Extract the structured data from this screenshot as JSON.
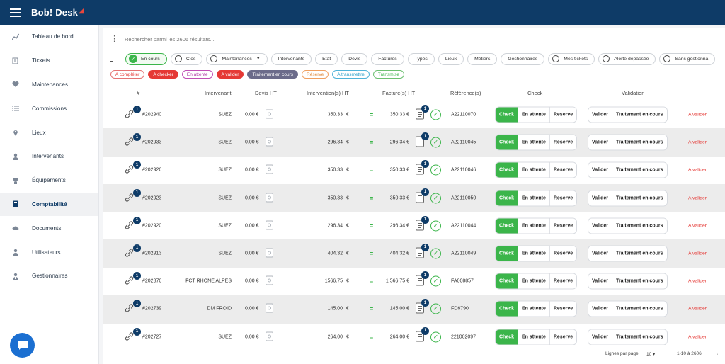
{
  "app": {
    "brand": "Bob! Desk"
  },
  "sidebar": {
    "items": [
      {
        "label": "Tableau de bord",
        "icon": "chart-line-icon",
        "active": false
      },
      {
        "label": "Tickets",
        "icon": "tickets-icon",
        "active": false
      },
      {
        "label": "Maintenances",
        "icon": "heart-pulse-icon",
        "active": false
      },
      {
        "label": "Commissions",
        "icon": "checklist-icon",
        "active": false
      },
      {
        "label": "Lieux",
        "icon": "map-pin-icon",
        "active": false
      },
      {
        "label": "Intervenants",
        "icon": "worker-icon",
        "active": false
      },
      {
        "label": "Équipements",
        "icon": "equipment-icon",
        "active": false
      },
      {
        "label": "Comptabilité",
        "icon": "calculator-icon",
        "active": true
      },
      {
        "label": "Documents",
        "icon": "cloud-icon",
        "active": false
      },
      {
        "label": "Utilisateurs",
        "icon": "user-icon",
        "active": false
      },
      {
        "label": "Gestionnaires",
        "icon": "manager-icon",
        "active": false
      }
    ]
  },
  "search": {
    "placeholder": "Rechercher parmi les 2606 résultats..."
  },
  "filters": [
    {
      "label": "En cours",
      "state": "checked"
    },
    {
      "label": "Clos",
      "state": "radio"
    },
    {
      "label": "Maintenances",
      "state": "radio-dropdown"
    },
    {
      "label": "Intervenants",
      "state": "plain"
    },
    {
      "label": "Etat",
      "state": "plain"
    },
    {
      "label": "Devis",
      "state": "plain"
    },
    {
      "label": "Factures",
      "state": "plain"
    },
    {
      "label": "Types",
      "state": "plain"
    },
    {
      "label": "Lieux",
      "state": "plain"
    },
    {
      "label": "Métiers",
      "state": "plain"
    },
    {
      "label": "Gestionnaires",
      "state": "plain"
    },
    {
      "label": "Mes tickets",
      "state": "radio"
    },
    {
      "label": "Alerte dépassée",
      "state": "radio"
    },
    {
      "label": "Sans gestionna",
      "state": "radio"
    }
  ],
  "status_pills": [
    {
      "label": "A compléter",
      "border": "#e57373",
      "bg": "#ffffff",
      "color": "#e53935"
    },
    {
      "label": "A checker",
      "border": "#e53935",
      "bg": "#e53935",
      "color": "#ffffff"
    },
    {
      "label": "En attente",
      "border": "#c04fb5",
      "bg": "#ffffff",
      "color": "#b13aa7"
    },
    {
      "label": "A valider",
      "border": "#e53935",
      "bg": "#e53935",
      "color": "#ffffff"
    },
    {
      "label": "Traitement en cours",
      "border": "#6b6b8a",
      "bg": "#6b6b8a",
      "color": "#ffffff"
    },
    {
      "label": "Réserve",
      "border": "#f0a060",
      "bg": "#ffffff",
      "color": "#e08a3c"
    },
    {
      "label": "A transmettre",
      "border": "#4fb3d9",
      "bg": "#ffffff",
      "color": "#2a9fc9"
    },
    {
      "label": "Transmise",
      "border": "#6cc070",
      "bg": "#ffffff",
      "color": "#3bb54a"
    }
  ],
  "table": {
    "headers": {
      "id": "#",
      "intervenant": "Intervenant",
      "devis": "Devis HT",
      "intervention": "Intervention(s) HT",
      "facture": "Facture(s) HT",
      "reference": "Référence(s)",
      "check": "Check",
      "validation": "Validation"
    },
    "rows": [
      {
        "badge": "1",
        "id": "#202940",
        "intervenant": "SUEZ",
        "devis": "0.00 €",
        "intervention": "350.33",
        "currency": "€",
        "eq": "=",
        "facture": "350.33 €",
        "doc_badge": "1",
        "reference": "A22110070",
        "check": "Check",
        "wait": "En attente",
        "reserve": "Reserve",
        "valider": "Valider",
        "traitement": "Traitement en cours",
        "status": "A valider"
      },
      {
        "badge": "1",
        "id": "#202933",
        "intervenant": "SUEZ",
        "devis": "0.00 €",
        "intervention": "296.34",
        "currency": "€",
        "eq": "=",
        "facture": "296.34 €",
        "doc_badge": "1",
        "reference": "A22110045",
        "check": "Check",
        "wait": "En attente",
        "reserve": "Reserve",
        "valider": "Valider",
        "traitement": "Traitement en cours",
        "status": "A valider"
      },
      {
        "badge": "1",
        "id": "#202926",
        "intervenant": "SUEZ",
        "devis": "0.00 €",
        "intervention": "350.33",
        "currency": "€",
        "eq": "=",
        "facture": "350.33 €",
        "doc_badge": "1",
        "reference": "A22110046",
        "check": "Check",
        "wait": "En attente",
        "reserve": "Reserve",
        "valider": "Valider",
        "traitement": "Traitement en cours",
        "status": "A valider"
      },
      {
        "badge": "1",
        "id": "#202923",
        "intervenant": "SUEZ",
        "devis": "0.00 €",
        "intervention": "350.33",
        "currency": "€",
        "eq": "=",
        "facture": "350.33 €",
        "doc_badge": "1",
        "reference": "A22110050",
        "check": "Check",
        "wait": "En attente",
        "reserve": "Reserve",
        "valider": "Valider",
        "traitement": "Traitement en cours",
        "status": "A valider"
      },
      {
        "badge": "1",
        "id": "#202920",
        "intervenant": "SUEZ",
        "devis": "0.00 €",
        "intervention": "296.34",
        "currency": "€",
        "eq": "=",
        "facture": "296.34 €",
        "doc_badge": "1",
        "reference": "A22110044",
        "check": "Check",
        "wait": "En attente",
        "reserve": "Reserve",
        "valider": "Valider",
        "traitement": "Traitement en cours",
        "status": "A valider"
      },
      {
        "badge": "1",
        "id": "#202913",
        "intervenant": "SUEZ",
        "devis": "0.00 €",
        "intervention": "404.32",
        "currency": "€",
        "eq": "=",
        "facture": "404.32 €",
        "doc_badge": "1",
        "reference": "A22110049",
        "check": "Check",
        "wait": "En attente",
        "reserve": "Reserve",
        "valider": "Valider",
        "traitement": "Traitement en cours",
        "status": "A valider"
      },
      {
        "badge": "1",
        "id": "#202876",
        "intervenant": "FCT RHONE ALPES",
        "devis": "0.00 €",
        "intervention": "1566.75",
        "currency": "€",
        "eq": "=",
        "facture": "1 566.75 €",
        "doc_badge": "1",
        "reference": "FA008857",
        "check": "Check",
        "wait": "En attente",
        "reserve": "Reserve",
        "valider": "Valider",
        "traitement": "Traitement en cours",
        "status": "A valider"
      },
      {
        "badge": "1",
        "id": "#202739",
        "intervenant": "DM FROID",
        "devis": "0.00 €",
        "intervention": "145.00",
        "currency": "€",
        "eq": "=",
        "facture": "145.00 €",
        "doc_badge": "1",
        "reference": "FD6790",
        "check": "Check",
        "wait": "En attente",
        "reserve": "Reserve",
        "valider": "Valider",
        "traitement": "Traitement en cours",
        "status": "A valider"
      },
      {
        "badge": "1",
        "id": "#202727",
        "intervenant": "SUEZ",
        "devis": "0.00 €",
        "intervention": "264.00",
        "currency": "€",
        "eq": "=",
        "facture": "264.00 €",
        "doc_badge": "1",
        "reference": "221002097",
        "check": "Check",
        "wait": "En attente",
        "reserve": "Reserve",
        "valider": "Valider",
        "traitement": "Traitement en cours",
        "status": "A valider"
      }
    ]
  },
  "footer": {
    "rows_per_page_label": "Lignes par page",
    "rows_per_page_value": "10",
    "range": "1-10 à 2606"
  },
  "colors": {
    "topbar": "#0e3b67",
    "accent_green": "#3bb54a",
    "alert_red": "#e53935"
  }
}
